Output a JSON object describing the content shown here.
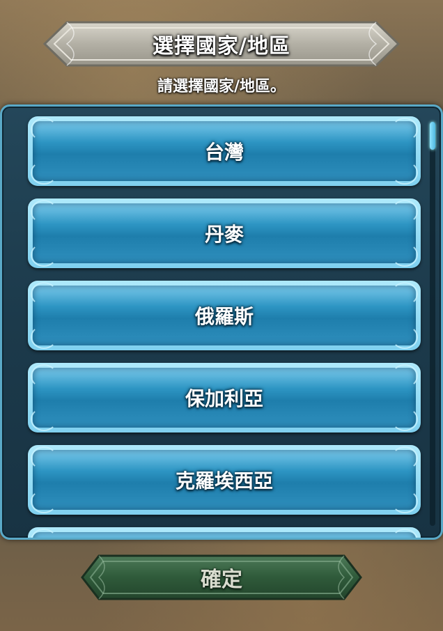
{
  "header": {
    "title": "選擇國家/地區",
    "subtitle": "請選擇國家/地區。"
  },
  "countries": [
    {
      "label": "台灣"
    },
    {
      "label": "丹麥"
    },
    {
      "label": "俄羅斯"
    },
    {
      "label": "保加利亞"
    },
    {
      "label": "克羅埃西亞"
    },
    {
      "label": ""
    }
  ],
  "footer": {
    "confirm_label": "確定"
  },
  "colors": {
    "list_button": "#2d95c3",
    "list_border": "#5aa9c7",
    "confirm_button": "#2f5a3a",
    "banner": "#b9b7ae"
  }
}
